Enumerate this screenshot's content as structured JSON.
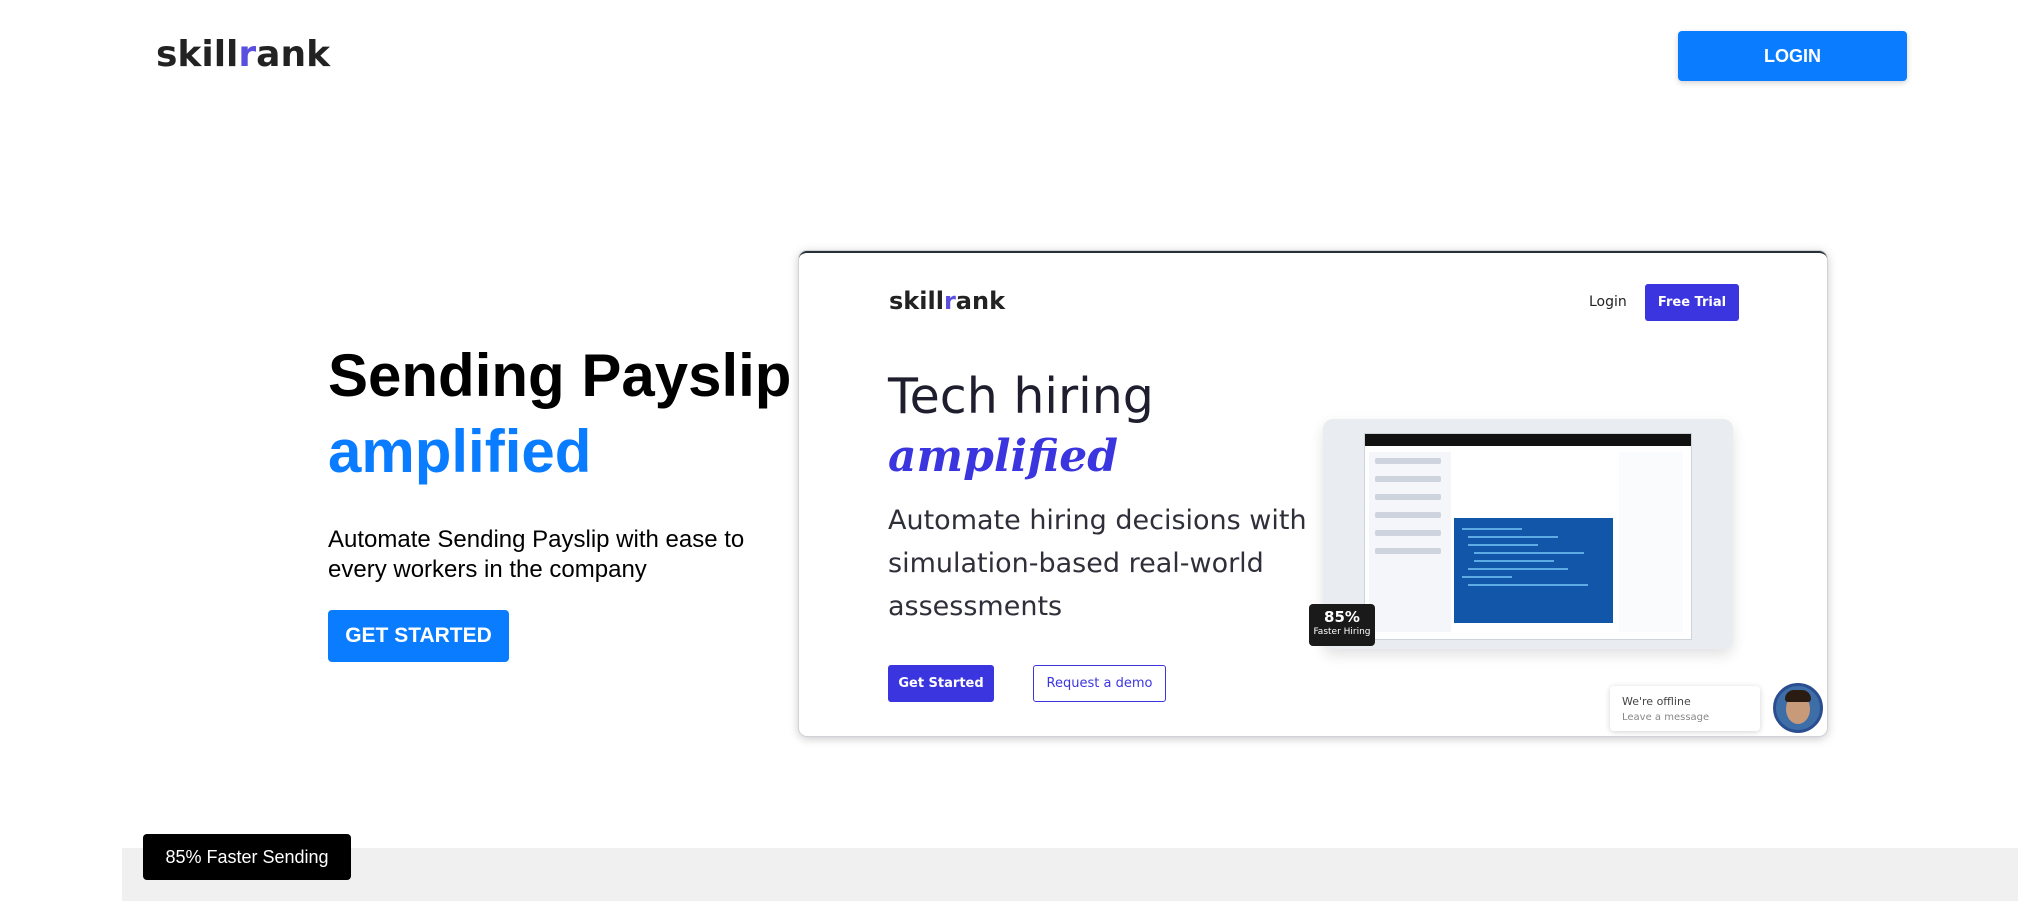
{
  "header": {
    "logo_text_prefix": "skill",
    "logo_text_r": "r",
    "logo_text_suffix": "ank",
    "login_label": "LOGIN"
  },
  "hero": {
    "title": "Sending Payslip",
    "accent": "amplified",
    "subtitle": "Automate Sending Payslip with ease to every workers in the company",
    "cta_label": "GET STARTED"
  },
  "preview": {
    "logo_text_prefix": "skill",
    "logo_text_r": "r",
    "logo_text_suffix": "ank",
    "login_label": "Login",
    "trial_label": "Free Trial",
    "title": "Tech hiring",
    "accent": "amplified",
    "subtitle": "Automate hiring decisions with simulation-based real-world assessments",
    "get_started_label": "Get Started",
    "demo_label": "Request a demo",
    "stat_value": "85%",
    "stat_label": "Faster Hiring",
    "chat_status": "We're offline",
    "chat_prompt": "Leave a message"
  },
  "bottom": {
    "badge": "85% Faster Sending"
  },
  "colors": {
    "accent_blue": "#0a7cff",
    "preview_purple": "#3b35e0"
  }
}
